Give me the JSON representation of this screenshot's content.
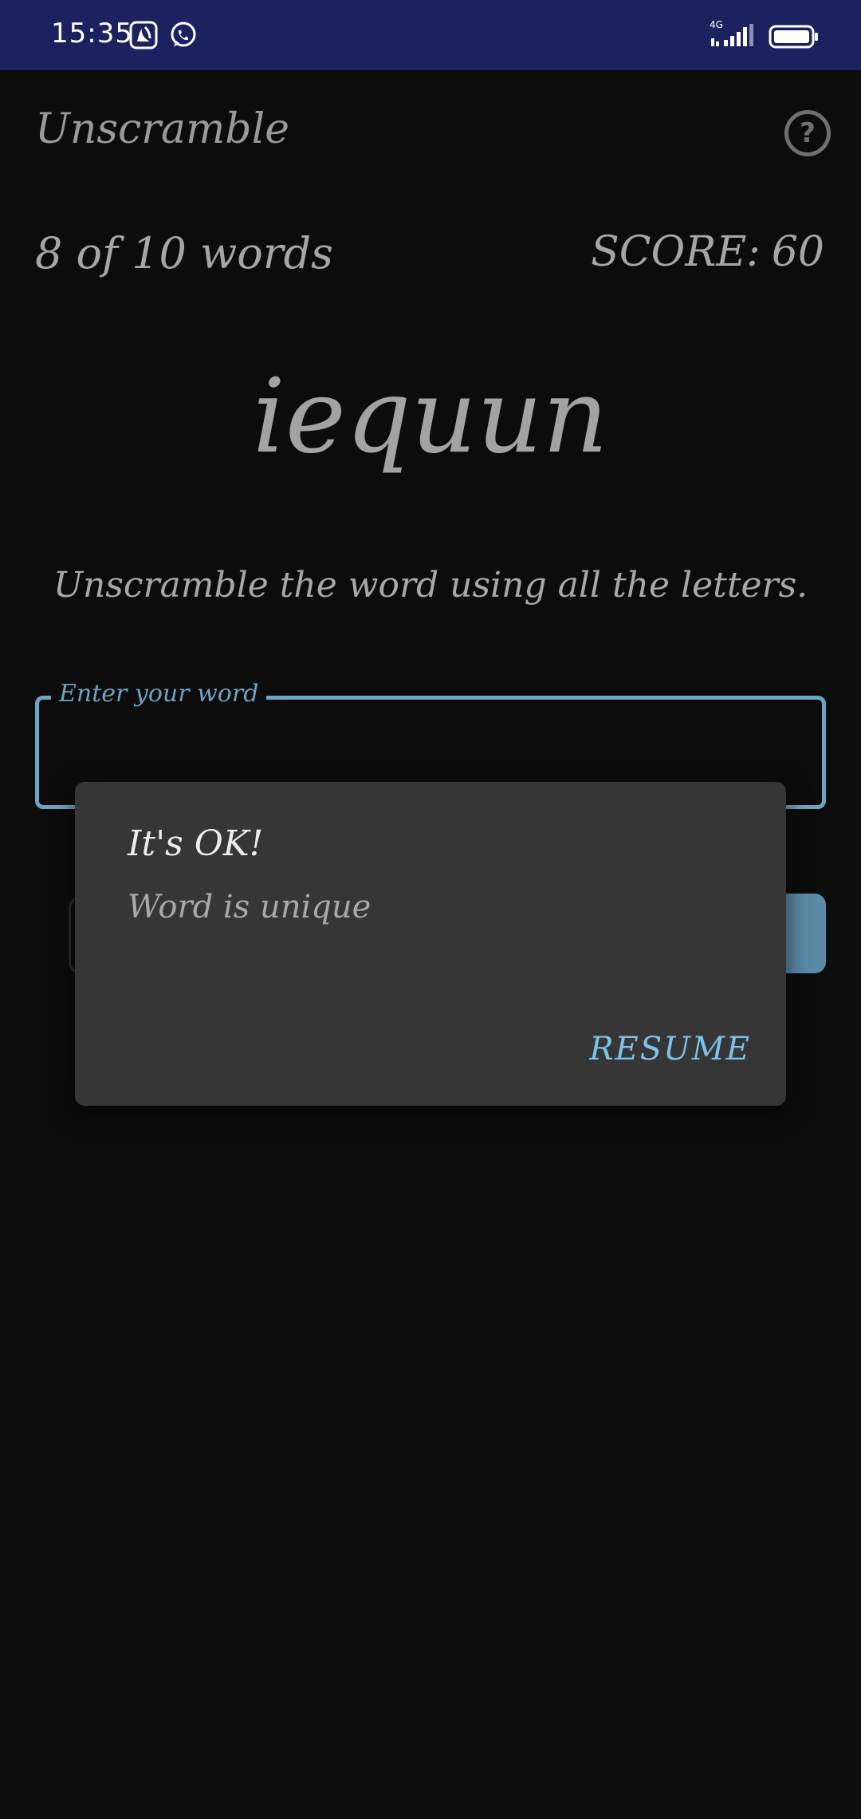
{
  "status_bar": {
    "time": "15:35",
    "network_label": "4G",
    "icons": [
      "jiosaavn-icon",
      "whatsapp-icon",
      "signal-icon",
      "battery-icon"
    ]
  },
  "app": {
    "title": "Unscramble",
    "help_icon": "help-circle-icon"
  },
  "game": {
    "word_count": "8 of 10 words",
    "score_label": "SCORE:",
    "score_value": "60",
    "scrambled_word": "iequun",
    "instructions": "Unscramble the word using all the letters."
  },
  "input": {
    "label": "Enter your word",
    "value": ""
  },
  "dialog": {
    "title": "It's OK!",
    "message": "Word is unique",
    "action": "RESUME"
  },
  "colors": {
    "status_bar": "#1c2160",
    "background": "#0c0c0c",
    "accent": "#6ea4c2",
    "dialog_background": "#363636",
    "dialog_action": "#7cc3ec"
  }
}
